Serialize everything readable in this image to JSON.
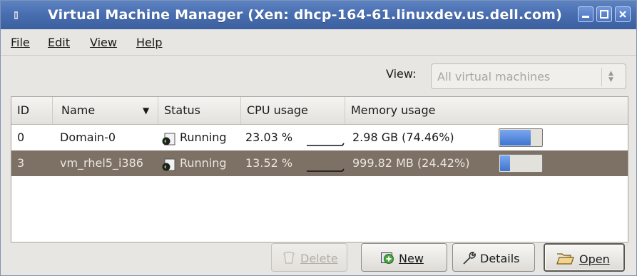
{
  "window": {
    "title": "Virtual Machine Manager (Xen: dhcp-164-61.linuxdev.us.dell.com)",
    "controls": [
      "minimize-icon",
      "maximize-icon",
      "close-icon"
    ]
  },
  "menubar": {
    "items": [
      {
        "label": "File",
        "mnemonic": "F"
      },
      {
        "label": "Edit",
        "mnemonic": "E"
      },
      {
        "label": "View",
        "mnemonic": "V"
      },
      {
        "label": "Help",
        "mnemonic": "H"
      }
    ]
  },
  "filter": {
    "label": "View:",
    "selected": "All virtual machines"
  },
  "table": {
    "columns": [
      "ID",
      "Name",
      "Status",
      "CPU usage",
      "Memory usage"
    ],
    "sort_indicator": "▼",
    "rows": [
      {
        "id": "0",
        "name": "Domain-0",
        "status": "Running",
        "cpu": "23.03 %",
        "memory": "2.98 GB (74.46%)",
        "memory_fraction": 0.7446,
        "selected": false
      },
      {
        "id": "3",
        "name": "vm_rhel5_i386",
        "status": "Running",
        "cpu": "13.52 %",
        "memory": "999.82 MB (24.42%)",
        "memory_fraction": 0.2442,
        "selected": true
      }
    ]
  },
  "buttons": {
    "delete": "Delete",
    "new": "New",
    "details": "Details",
    "open": "Open"
  },
  "colors": {
    "titlebar": "#4a6fb1",
    "selection": "#7d7064",
    "progress": "#3f74cf"
  }
}
